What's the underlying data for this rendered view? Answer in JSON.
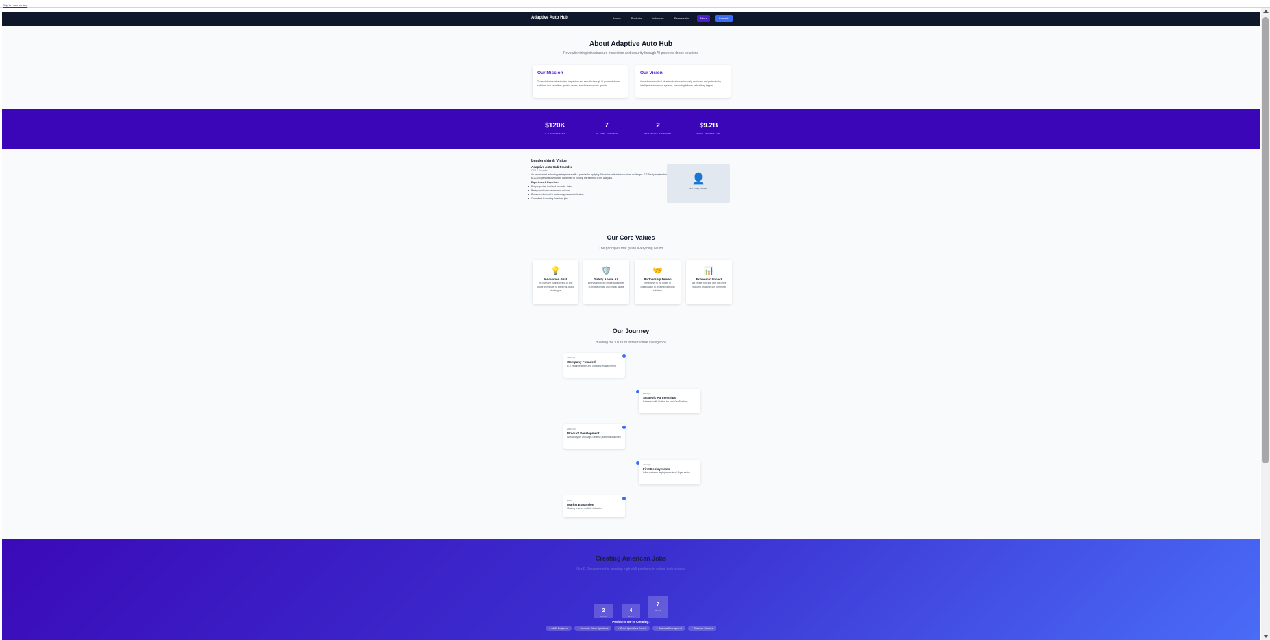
{
  "skip_link": "Skip to main content",
  "nav": {
    "brand": "Adaptive Auto Hub",
    "links": [
      "Home",
      "Products",
      "Industries",
      "Partnerships",
      "About",
      "Contact"
    ]
  },
  "hero": {
    "title": "About Adaptive Auto Hub",
    "subtitle": "Revolutionizing infrastructure inspection and security through AI-powered drone solutions"
  },
  "mission": {
    "title": "Our Mission",
    "text": "To revolutionize infrastructure inspection and security through AI-powered drone solutions that save lives, protect assets, and drive economic growth."
  },
  "vision": {
    "title": "Our Vision",
    "text": "A world where critical infrastructure is continuously monitored and protected by intelligent autonomous systems, preventing failures before they happen."
  },
  "stats": [
    {
      "value": "$120K",
      "label": "E-2 INVESTMENT"
    },
    {
      "value": "7",
      "label": "US JOBS CREATED"
    },
    {
      "value": "2",
      "label": "STRATEGIC PARTNERS"
    },
    {
      "value": "$9.2B",
      "label": "TOTAL MARKET SIZE"
    }
  ],
  "leadership": {
    "heading": "Leadership & Vision",
    "name": "Adaptive Auto Hub Founder",
    "role": "CEO & Founder",
    "bio": "An experienced technology entrepreneur with a passion for applying AI to solve critical infrastructure challenges. E-2 Treaty Investor bringing cutting-edge drone technology to the US market. 🇺🇸 $120,000 personal investment committed to building the future of drone analytics.",
    "expertise_heading": "Experience & Expertise:",
    "expertise": [
      "Deep expertise in AI and computer vision",
      "Background in aerospace and defense",
      "Proven track record in technology commercialization",
      "Committed to creating American jobs"
    ],
    "photo_icon": "person-icon",
    "photo_caption": "E-2 Treaty Investor"
  },
  "values": {
    "title": "Our Core Values",
    "subtitle": "The principles that guide everything we do",
    "items": [
      {
        "icon": "💡",
        "title": "Innovation First",
        "text": "We push the boundaries of AI and drone technology to solve real-world challenges"
      },
      {
        "icon": "🛡️",
        "title": "Safety Above All",
        "text": "Every solution we create is designed to protect people and critical assets"
      },
      {
        "icon": "🤝",
        "title": "Partnership Driven",
        "text": "We believe in the power of collaboration to create exceptional solutions"
      },
      {
        "icon": "📊",
        "title": "Economic Impact",
        "text": "We create high-skill jobs and drive economic growth in our community"
      }
    ]
  },
  "journey": {
    "title": "Our Journey",
    "subtitle": "Building the future of infrastructure intelligence",
    "items": [
      {
        "date": "2024 Q1",
        "title": "Company Founded",
        "text": "E-2 visa investment and company establishment"
      },
      {
        "date": "2024 Q2",
        "title": "Strategic Partnerships",
        "text": "Partnered with Skyline Inc. and GeoFrontiers"
      },
      {
        "date": "2024 Q3",
        "title": "Product Development",
        "text": "AeroAnalytics and Aegis Defense platforms launched"
      },
      {
        "date": "2024 Q4",
        "title": "First Deployments",
        "text": "Initial customer deployments in oil & gas sector"
      },
      {
        "date": "2025",
        "title": "Market Expansion",
        "text": "Scaling to serve multiple industries"
      }
    ]
  },
  "jobs": {
    "title": "Creating American Jobs",
    "subtitle": "Our E-2 investment is creating high-skill positions in critical tech sectors",
    "bars": [
      {
        "value": "2",
        "label": "Current"
      },
      {
        "value": "4",
        "label": "Year 1"
      },
      {
        "value": "7",
        "label": "Year 3"
      }
    ],
    "positions_title": "Positions We're Creating:",
    "positions": [
      "✓ AI/ML Engineers",
      "✓ Computer Vision Specialists",
      "✓ Drone Operations Experts",
      "✓ Business Development",
      "✓ Customer Success"
    ]
  }
}
